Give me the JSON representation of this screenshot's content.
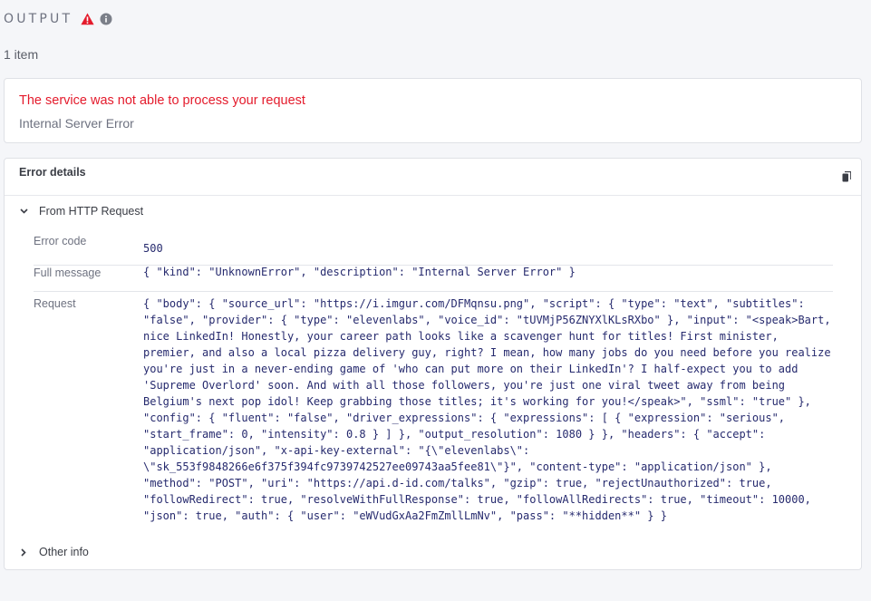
{
  "header": {
    "title": "OUTPUT",
    "warning_icon": "warning-triangle-icon",
    "info_icon": "info-circle-icon",
    "warning_color": "#e41b2c"
  },
  "item_count": "1 item",
  "error": {
    "title": "The service was not able to process your request",
    "subtitle": "Internal Server Error"
  },
  "details": {
    "title": "Error details",
    "copy_icon": "copy-icon",
    "http_section": {
      "label": "From HTTP Request",
      "expanded": true,
      "rows": [
        {
          "key": "Error code",
          "value": "500"
        },
        {
          "key": "Full message",
          "value": "{ \"kind\": \"UnknownError\", \"description\": \"Internal Server Error\" }"
        },
        {
          "key": "Request",
          "value": "{ \"body\": { \"source_url\": \"https://i.imgur.com/DFMqnsu.png\", \"script\": { \"type\": \"text\", \"subtitles\": \"false\", \"provider\": { \"type\": \"elevenlabs\", \"voice_id\": \"tUVMjP56ZNYXlKLsRXbo\" }, \"input\": \"<speak>Bart, nice LinkedIn! Honestly, your career path looks like a scavenger hunt for titles! First minister, premier, and also a local pizza delivery guy, right? I mean, how many jobs do you need before you realize you're just in a never-ending game of 'who can put more on their LinkedIn'? I half-expect you to add 'Supreme Overlord' soon. And with all those followers, you're just one viral tweet away from being Belgium's next pop idol! Keep grabbing those titles; it's working for you!</speak>\", \"ssml\": \"true\" }, \"config\": { \"fluent\": \"false\", \"driver_expressions\": { \"expressions\": [ { \"expression\": \"serious\", \"start_frame\": 0, \"intensity\": 0.8 } ] }, \"output_resolution\": 1080 } }, \"headers\": { \"accept\": \"application/json\", \"x-api-key-external\": \"{\\\"elevenlabs\\\": \\\"sk_553f9848266e6f375f394fc9739742527ee09743aa5fee81\\\"}\", \"content-type\": \"application/json\" }, \"method\": \"POST\", \"uri\": \"https://api.d-id.com/talks\", \"gzip\": true, \"rejectUnauthorized\": true, \"followRedirect\": true, \"resolveWithFullResponse\": true, \"followAllRedirects\": true, \"timeout\": 10000, \"json\": true, \"auth\": { \"user\": \"eWVudGxAa2FmZmllLmNv\", \"pass\": \"**hidden**\" } }"
        }
      ]
    },
    "other_section": {
      "label": "Other info",
      "expanded": false
    }
  }
}
